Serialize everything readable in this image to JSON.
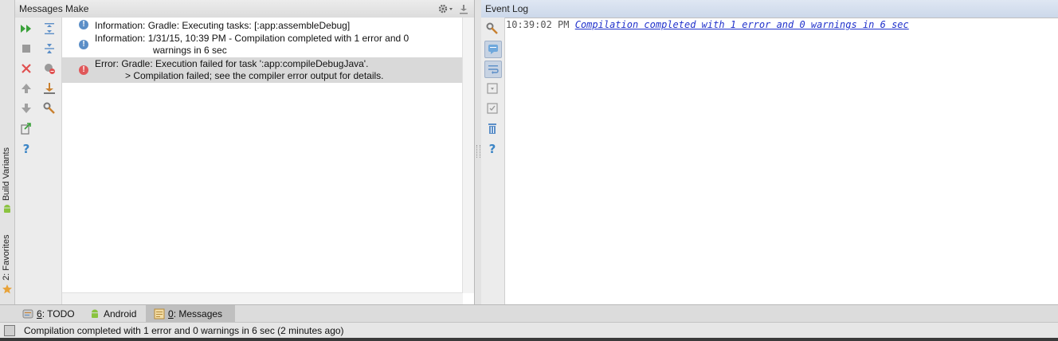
{
  "left_strip": {
    "build_variants_label": "Build Variants",
    "favorites_label": "2: Favorites"
  },
  "messages_panel": {
    "title": "Messages Make",
    "messages": [
      {
        "type": "info",
        "lines": [
          "Information: Gradle: Executing tasks: [:app:assembleDebug]"
        ]
      },
      {
        "type": "info",
        "lines": [
          "Information: 1/31/15, 10:39 PM - Compilation completed with 1 error and 0",
          "warnings in 6 sec"
        ]
      },
      {
        "type": "error",
        "lines": [
          "Error: Gradle: Execution failed for task ':app:compileDebugJava'.",
          "> Compilation failed; see the compiler error output for details."
        ]
      }
    ]
  },
  "event_log": {
    "title": "Event Log",
    "entries": [
      {
        "time": "10:39:02 PM",
        "text": "Compilation completed with 1 error and 0 warnings in 6 sec"
      }
    ]
  },
  "bottom_tabs": [
    {
      "mnemonic": "6",
      "label": ": TODO",
      "icon": "todo-icon"
    },
    {
      "mnemonic": "",
      "label": "Android",
      "icon": "android-icon"
    },
    {
      "mnemonic": "0",
      "label": ": Messages",
      "icon": "messages-icon",
      "active": true
    }
  ],
  "status_bar": {
    "text": "Compilation completed with 1 error and 0 warnings in 6 sec (2 minutes ago)"
  },
  "colors": {
    "info_icon": "#5b8ec7",
    "error_icon": "#e0585a",
    "run_icon": "#3aa13a",
    "link": "#2233cc"
  }
}
